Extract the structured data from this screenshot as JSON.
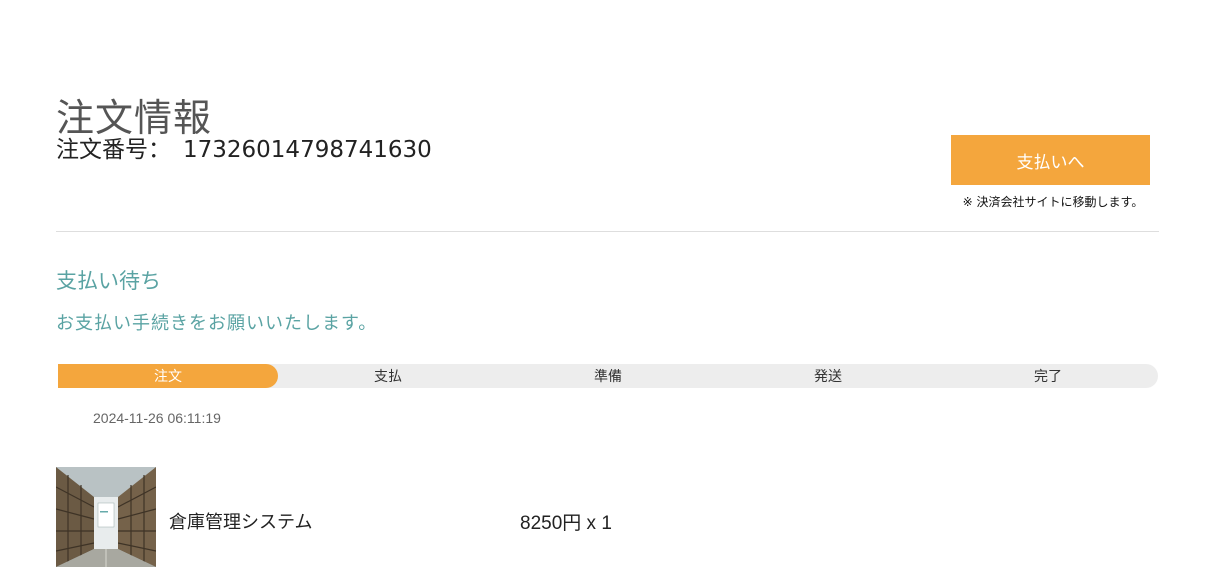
{
  "page": {
    "title": "注文情報",
    "order_label": "注文番号：",
    "order_number": "17326014798741630"
  },
  "payment": {
    "button_label": "支払いへ",
    "note": "※ 決済会社サイトに移動します。",
    "button_color": "#f4a63d"
  },
  "status": {
    "title": "支払い待ち",
    "message": "お支払い手続きをお願いいたします。",
    "color": "#5aa3a3"
  },
  "progress": {
    "current_step": 1,
    "steps": [
      {
        "label": "注文",
        "active": true
      },
      {
        "label": "支払",
        "active": false
      },
      {
        "label": "準備",
        "active": false
      },
      {
        "label": "発送",
        "active": false
      },
      {
        "label": "完了",
        "active": false
      }
    ]
  },
  "timestamp": "2024-11-26 06:11:19",
  "product": {
    "name": "倉庫管理システム",
    "price": "8250円 x 1",
    "image": "warehouse-image"
  }
}
